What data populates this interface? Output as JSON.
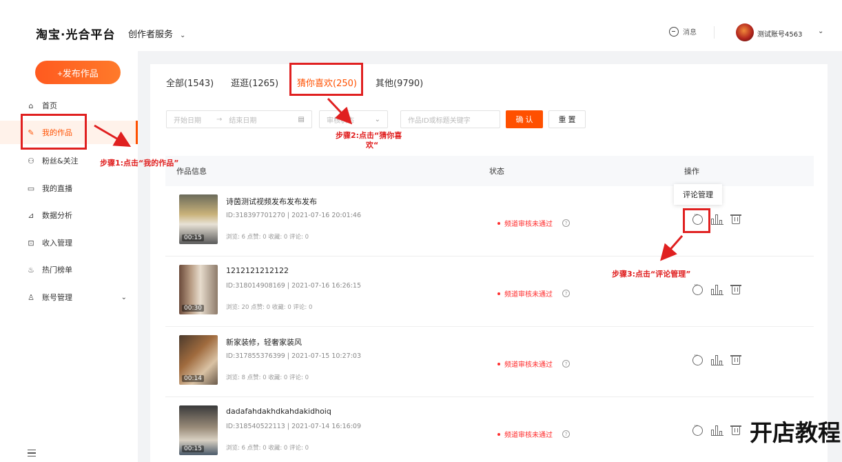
{
  "header": {
    "logo": "淘宝·光合平台",
    "service": "创作者服务",
    "message": "消息",
    "account": "测试账号4563"
  },
  "sidebar": {
    "publish": "+发布作品",
    "items": [
      {
        "label": "首页",
        "icon": "home-icon"
      },
      {
        "label": "我的作品",
        "icon": "pen-icon"
      },
      {
        "label": "粉丝&关注",
        "icon": "users-icon"
      },
      {
        "label": "我的直播",
        "icon": "live-icon"
      },
      {
        "label": "数据分析",
        "icon": "chart-icon"
      },
      {
        "label": "收入管理",
        "icon": "wallet-icon"
      },
      {
        "label": "热门榜单",
        "icon": "flame-icon"
      },
      {
        "label": "账号管理",
        "icon": "person-icon"
      }
    ]
  },
  "tabs": [
    "全部(1543)",
    "逛逛(1265)",
    "猜你喜欢(250)",
    "其他(9790)"
  ],
  "filters": {
    "start_date": "开始日期",
    "arrow": "→",
    "end_date": "结束日期",
    "status": "审核状态",
    "search": "作品ID或标题关键字",
    "confirm": "确 认",
    "reset": "重 置"
  },
  "table": {
    "headers": [
      "作品信息",
      "状态",
      "操作"
    ],
    "rows": [
      {
        "title": "诗茵测试视频发布发布发布",
        "meta": "ID:318397701270 | 2021-07-16 20:01:46",
        "stats": "浏览: 6  点赞: 0  收藏: 0  评论: 0",
        "duration": "00:15",
        "status": "频道审核未通过"
      },
      {
        "title": "1212121212122",
        "meta": "ID:318014908169 | 2021-07-16 16:26:15",
        "stats": "浏览: 20  点赞: 0  收藏: 0  评论: 0",
        "duration": "00:30",
        "status": "频道审核未通过"
      },
      {
        "title": "新家装修，轻奢家装风",
        "meta": "ID:317855376399 | 2021-07-15 10:27:03",
        "stats": "浏览: 8  点赞: 0  收藏: 0  评论: 0",
        "duration": "00:14",
        "status": "频道审核未通过"
      },
      {
        "title": "dadafahdakhdkahdakidhoiq",
        "meta": "ID:318540522113 | 2021-07-14 16:16:09",
        "stats": "浏览: 6  点赞: 0  收藏: 0  评论: 0",
        "duration": "00:15",
        "status": "频道审核未通过"
      }
    ]
  },
  "tooltip": "评论管理",
  "annotations": {
    "step1": "步骤1:点击“我的作品”",
    "step2_line1": "步骤2:点击“猜你喜",
    "step2_line2": "欢“",
    "step3": "步骤3:点击“评论管理”"
  },
  "watermark": "开店教程",
  "colors": {
    "accent": "#ff5000",
    "annotation": "#e02020",
    "error": "#ff2d2d"
  }
}
